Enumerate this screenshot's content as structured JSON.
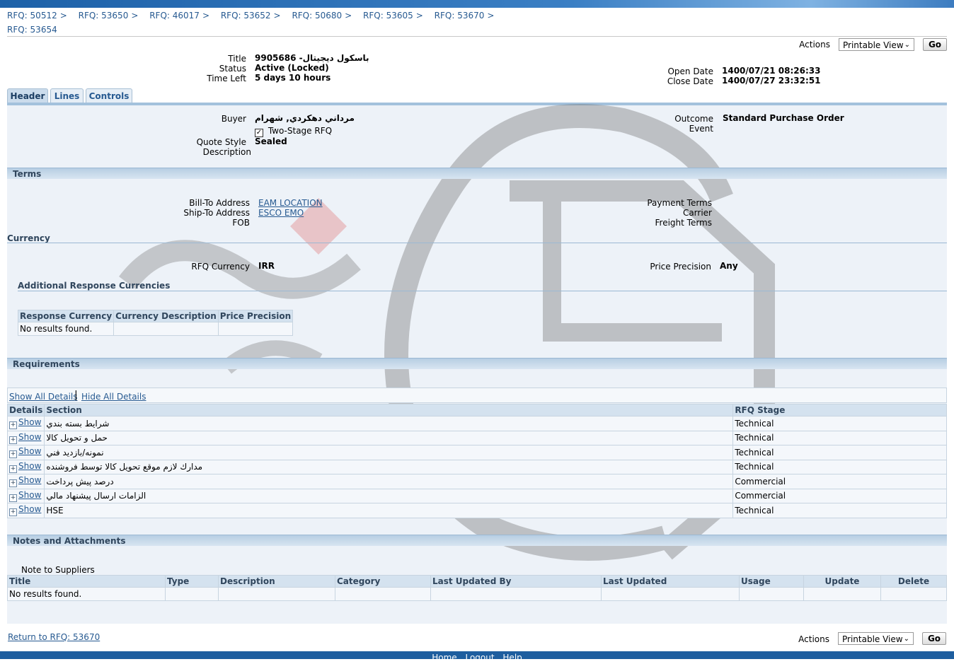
{
  "breadcrumbs": [
    "RFQ: 50512",
    "RFQ: 53650",
    "RFQ: 46017",
    "RFQ: 53652",
    "RFQ: 50680",
    "RFQ: 53605",
    "RFQ: 53670"
  ],
  "breadcrumb_sep": ">",
  "page_title": "RFQ: 53654",
  "actions": {
    "label": "Actions",
    "selected": "Printable View",
    "go": "Go"
  },
  "summary": {
    "title_label": "Title",
    "title_value": "9905686 -باسکول ديجيتال",
    "status_label": "Status",
    "status_value": "Active (Locked)",
    "time_left_label": "Time Left",
    "time_left_value": "5 days 10 hours",
    "open_date_label": "Open Date",
    "open_date_value": "1400/07/21 08:26:33",
    "close_date_label": "Close Date",
    "close_date_value": "1400/07/27 23:32:51"
  },
  "tabs": [
    "Header",
    "Lines",
    "Controls"
  ],
  "header": {
    "buyer_label": "Buyer",
    "buyer_value": "مرداني دهکردي, شهرام",
    "two_stage_label": "Two-Stage RFQ",
    "two_stage_checked": true,
    "quote_style_label": "Quote Style",
    "quote_style_value": "Sealed",
    "description_label": "Description",
    "outcome_label": "Outcome",
    "outcome_value": "Standard Purchase Order",
    "event_label": "Event"
  },
  "terms": {
    "section": "Terms",
    "bill_to_label": "Bill-To Address",
    "bill_to_value": "EAM LOCATION",
    "ship_to_label": "Ship-To Address",
    "ship_to_value": "ESCO EMO",
    "fob_label": "FOB",
    "payment_terms_label": "Payment Terms",
    "carrier_label": "Carrier",
    "freight_terms_label": "Freight Terms"
  },
  "currency": {
    "section": "Currency",
    "rfq_currency_label": "RFQ Currency",
    "rfq_currency_value": "IRR",
    "price_precision_label": "Price Precision",
    "price_precision_value": "Any",
    "additional_title": "Additional Response Currencies",
    "columns": [
      "Response Currency",
      "Currency Description",
      "Price Precision"
    ],
    "empty": "No results found."
  },
  "requirements": {
    "section": "Requirements",
    "show_all": "Show All Details",
    "hide_all": "Hide All Details",
    "columns": [
      "Details",
      "Section",
      "RFQ Stage"
    ],
    "show_label": "Show",
    "rows": [
      {
        "section": "شرايط بسته بندي",
        "stage": "Technical"
      },
      {
        "section": "حمل و تحويل کالا",
        "stage": "Technical"
      },
      {
        "section": "نمونه/بازديد فني",
        "stage": "Technical"
      },
      {
        "section": "مدارك لازم موقع تحويل كالا توسط فروشنده",
        "stage": "Technical"
      },
      {
        "section": "درصد پيش پرداخت",
        "stage": "Commercial"
      },
      {
        "section": "الزامات ارسال پيشنهاد مالي",
        "stage": "Commercial"
      },
      {
        "section": "HSE",
        "stage": "Technical"
      }
    ]
  },
  "notes": {
    "section": "Notes and Attachments",
    "note_label": "Note to Suppliers",
    "columns": [
      "Title",
      "Type",
      "Description",
      "Category",
      "Last Updated By",
      "Last Updated",
      "Usage",
      "Update",
      "Delete"
    ],
    "empty": "No results found."
  },
  "return_link": "Return to RFQ: 53670",
  "footer": [
    "Home",
    "Logout",
    "Help"
  ],
  "colors": {
    "link": "#275a91",
    "section_bg": "#edf2f8",
    "header_bar": "#1d61a8"
  }
}
